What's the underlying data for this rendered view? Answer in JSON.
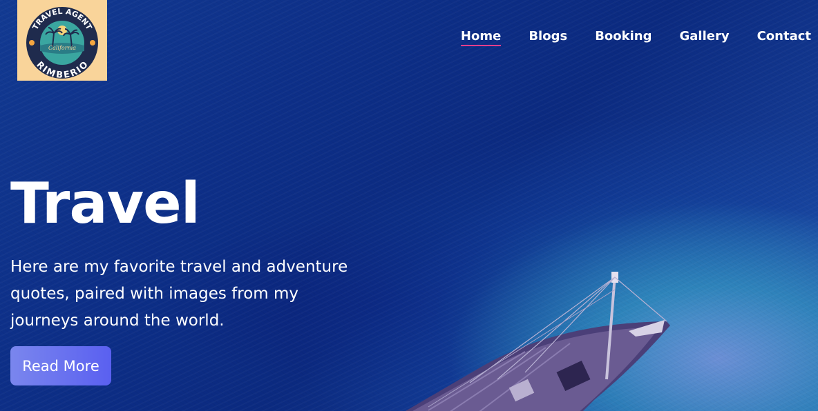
{
  "logo": {
    "top_text": "TRAVEL AGENT",
    "script_text": "California",
    "bottom_text": "RIMBERIO",
    "colors": {
      "background": "#f9d49a",
      "ring": "#1f2b4d",
      "inner": "#3aa6a0",
      "sun": "#f4a640"
    }
  },
  "nav": {
    "items": [
      {
        "label": "Home",
        "active": true
      },
      {
        "label": "Blogs"
      },
      {
        "label": "Booking"
      },
      {
        "label": "Gallery"
      },
      {
        "label": "Contact"
      }
    ],
    "active_underline_color": "#e83e8c"
  },
  "hero": {
    "title": "Travel",
    "description": "Here are my favorite travel and adventure quotes, paired with images from my journeys around the world.",
    "button_label": "Read More",
    "background_image": "aerial-ocean-with-boat",
    "colors": {
      "ocean": "#0d2f88",
      "button_start": "#7a86ee",
      "button_end": "#5a60f0"
    }
  }
}
